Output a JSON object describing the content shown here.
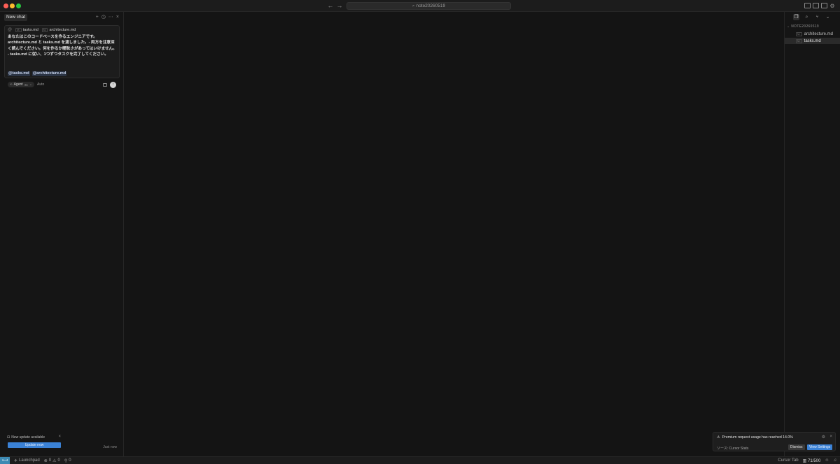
{
  "titlebar": {
    "search_text": "note20260519",
    "back_icon": "arrow-left-icon",
    "forward_icon": "arrow-right-icon"
  },
  "chat": {
    "tab_label": "New chat",
    "context_files": [
      "tasks.md",
      "architecture.md"
    ],
    "prompt_lines": [
      "あなたはこのコードベースを作るエンジニアです。",
      "architecture.md と tasks.md を渡しました。- 両方を注意深",
      "く読んでください。何を作るか曖昧さがあってはいけません。",
      "- tasks.md に従い、1つずつタスクを完了してください。"
    ],
    "mentions": [
      "@tasks.md",
      "@architecture.md"
    ],
    "mode_label": "Agent",
    "mode_shortcut": "⌘I",
    "model_label": "Auto",
    "update_title": "New update available",
    "update_button": "Update now",
    "timestamp": "Just now"
  },
  "explorer": {
    "folder_name": "NOTE20260519",
    "files": [
      "architecture.md",
      "tasks.md"
    ],
    "selected_file": "tasks.md"
  },
  "notification": {
    "title": "Premium request usage has reached 14.0%",
    "source": "ソース: Cursor Stats",
    "dismiss_label": "Dismiss",
    "view_label": "View Settings"
  },
  "statusbar": {
    "launchpad_label": "Launchpad",
    "errors": "0",
    "warnings": "0",
    "ports": "0",
    "cursor_tab_label": "Cursor Tab",
    "usage_meter": "71/500"
  },
  "colors": {
    "accent": "#3b82d6",
    "remote": "#3d8ab3",
    "background": "#141414"
  }
}
